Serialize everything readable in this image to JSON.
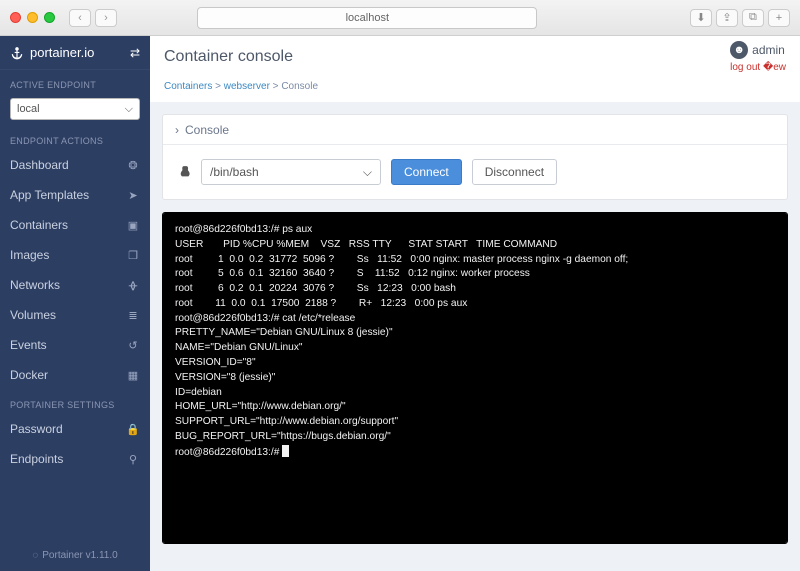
{
  "browser": {
    "url": "localhost"
  },
  "brand": "portainer.io",
  "sidebar": {
    "active_endpoint_label": "ACTIVE ENDPOINT",
    "endpoint_value": "local",
    "endpoint_actions_label": "ENDPOINT ACTIONS",
    "items": [
      {
        "label": "Dashboard",
        "icon": "tachometer"
      },
      {
        "label": "App Templates",
        "icon": "rocket"
      },
      {
        "label": "Containers",
        "icon": "cubes"
      },
      {
        "label": "Images",
        "icon": "clone"
      },
      {
        "label": "Networks",
        "icon": "sitemap"
      },
      {
        "label": "Volumes",
        "icon": "database"
      },
      {
        "label": "Events",
        "icon": "history"
      },
      {
        "label": "Docker",
        "icon": "th"
      }
    ],
    "settings_label": "PORTAINER SETTINGS",
    "settings": [
      {
        "label": "Password",
        "icon": "lock"
      },
      {
        "label": "Endpoints",
        "icon": "plug"
      }
    ],
    "footer": "Portainer v1.11.0"
  },
  "header": {
    "title": "Container console",
    "breadcrumb": [
      "Containers",
      "webserver",
      "Console"
    ],
    "user": "admin",
    "logout": "log out"
  },
  "console_panel": {
    "title": "Console",
    "shell": "/bin/bash",
    "connect": "Connect",
    "disconnect": "Disconnect"
  },
  "terminal_text": "root@86d226f0bd13:/# ps aux\nUSER       PID %CPU %MEM    VSZ   RSS TTY      STAT START   TIME COMMAND\nroot         1  0.0  0.2  31772  5096 ?        Ss   11:52   0:00 nginx: master process nginx -g daemon off;\nroot         5  0.6  0.1  32160  3640 ?        S    11:52   0:12 nginx: worker process\nroot         6  0.2  0.1  20224  3076 ?        Ss   12:23   0:00 bash\nroot        11  0.0  0.1  17500  2188 ?        R+   12:23   0:00 ps aux\nroot@86d226f0bd13:/# cat /etc/*release\nPRETTY_NAME=\"Debian GNU/Linux 8 (jessie)\"\nNAME=\"Debian GNU/Linux\"\nVERSION_ID=\"8\"\nVERSION=\"8 (jessie)\"\nID=debian\nHOME_URL=\"http://www.debian.org/\"\nSUPPORT_URL=\"http://www.debian.org/support\"\nBUG_REPORT_URL=\"https://bugs.debian.org/\"\nroot@86d226f0bd13:/# "
}
